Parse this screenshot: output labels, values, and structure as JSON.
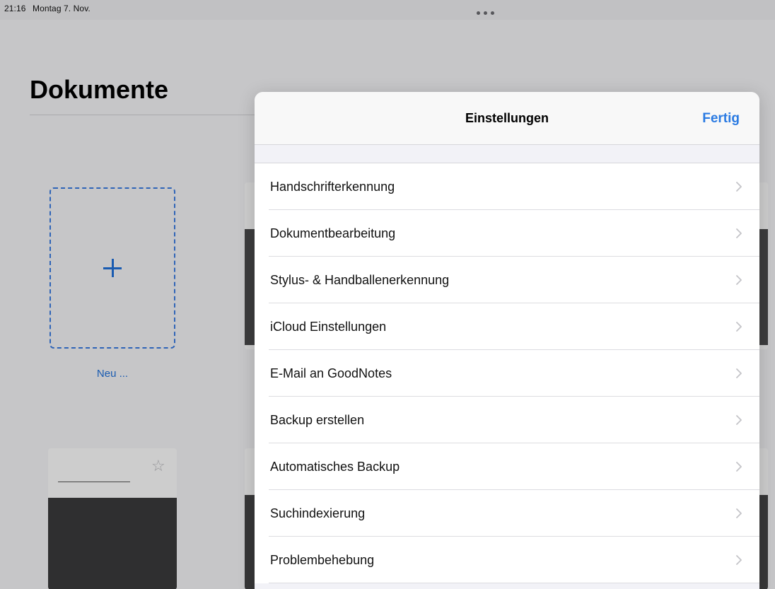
{
  "statusbar": {
    "time": "21:16",
    "date": "Montag 7. Nov."
  },
  "documents": {
    "title": "Dokumente",
    "new_label": "Neu ..."
  },
  "settings": {
    "title": "Einstellungen",
    "done_label": "Fertig",
    "items": [
      {
        "label": "Handschrifterkennung"
      },
      {
        "label": "Dokumentbearbeitung"
      },
      {
        "label": "Stylus- & Handballenerkennung"
      },
      {
        "label": "iCloud Einstellungen"
      },
      {
        "label": "E-Mail an GoodNotes"
      },
      {
        "label": "Backup erstellen"
      },
      {
        "label": "Automatisches Backup"
      },
      {
        "label": "Suchindexierung"
      },
      {
        "label": "Problembehebung"
      }
    ]
  },
  "colors": {
    "accent": "#2a7ae2",
    "sheet_bg": "#f2f2f7"
  },
  "icons": {
    "row_disclosure": "chevron-right-icon",
    "favorite": "star-outline-icon",
    "new": "plus-icon"
  }
}
